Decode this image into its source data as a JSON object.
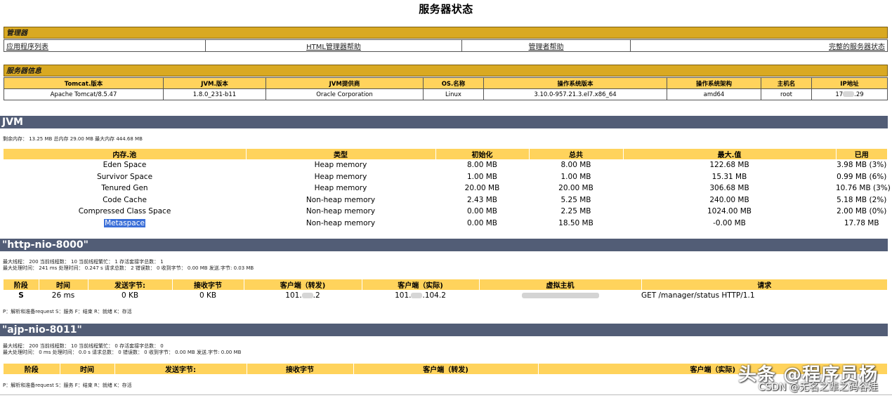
{
  "page_title": "服务器状态",
  "manager": {
    "heading": "管理器",
    "links": [
      "应用程序列表",
      "HTML管理器帮助",
      "管理者帮助",
      "完整的服务器状态"
    ]
  },
  "server_info": {
    "heading": "服务器信息",
    "headers": [
      "Tomcat.版本",
      "JVM.版本",
      "JVM提供商",
      "OS.名称",
      "操作系统版本",
      "操作系统架构",
      "主机名",
      "IP地址"
    ],
    "values": [
      "Apache Tomcat/8.5.47",
      "1.8.0_231-b11",
      "Oracle Corporation",
      "Linux",
      "3.10.0-957.21.3.el7.x86_64",
      "amd64",
      "root",
      "17",
      ".29"
    ]
  },
  "jvm": {
    "heading": "JVM",
    "summary": "剩余内存： 13.25 MB 总内存 29.00 MB 最大内存 444.68 MB",
    "headers": [
      "内存.池",
      "类型",
      "初始化",
      "总共",
      "最大.值",
      "已用"
    ],
    "rows": [
      [
        "Eden Space",
        "Heap memory",
        "8.00 MB",
        "8.00 MB",
        "122.68 MB",
        "3.98 MB (3%)"
      ],
      [
        "Survivor Space",
        "Heap memory",
        "1.00 MB",
        "1.00 MB",
        "15.31 MB",
        "0.99 MB (6%)"
      ],
      [
        "Tenured Gen",
        "Heap memory",
        "20.00 MB",
        "20.00 MB",
        "306.68 MB",
        "10.76 MB (3%)"
      ],
      [
        "Code Cache",
        "Non-heap memory",
        "2.43 MB",
        "5.25 MB",
        "240.00 MB",
        "5.18 MB (2%)"
      ],
      [
        "Compressed Class Space",
        "Non-heap memory",
        "0.00 MB",
        "2.25 MB",
        "1024.00 MB",
        "2.00 MB (0%)"
      ],
      [
        "Metaspace",
        "Non-heap memory",
        "0.00 MB",
        "18.50 MB",
        "-0.00 MB",
        "17.78 MB"
      ]
    ]
  },
  "http": {
    "heading": "\"http-nio-8000\"",
    "line1": "最大线程： 200 当前线程数： 10 当前线程繁忙： 1 存活套接字总数： 1",
    "line2": "最大处理时间： 241 ms 处理时间： 0.247 s 请求总数： 2 错误数： 0 收到字节： 0.00 MB 发送.字节: 0.03 MB",
    "headers": [
      "阶段",
      "时间",
      "发送字节:",
      "接收字节",
      "客户端（转发)",
      "客户端（实际)",
      "虚拟主机",
      "请求"
    ],
    "row": {
      "stage": "S",
      "time": "26 ms",
      "sent": "0 KB",
      "received": "0 KB",
      "client_fwd_a": "101.",
      "client_fwd_b": ".2",
      "client_real_a": "101.",
      "client_real_b": ".104.2",
      "request": "GET /manager/status HTTP/1.1"
    },
    "legend": "P：解析和准备request S：服务 F：结束 R：就绪 K：存活"
  },
  "ajp": {
    "heading": "\"ajp-nio-8011\"",
    "line1": "最大线程： 200 当前线程数： 10 当前线程繁忙： 0 存活套接字总数： 0",
    "line2": "最大处理时间： 0 ms 处理时间： 0.0 s 请求总数： 0 错误数： 0 收到字节： 0.00 MB 发送.字节: 0.00 MB",
    "headers": [
      "阶段",
      "时间",
      "发送字节:",
      "接收字节",
      "客户端（转发)",
      "客户端（实际)"
    ],
    "legend": "P：解析和准备request S：服务 F：结束 R：就绪 K：存活"
  },
  "watermark": {
    "main": "头条 @程序员杨",
    "sub": "CSDN @无名之辈之码谷娃"
  }
}
